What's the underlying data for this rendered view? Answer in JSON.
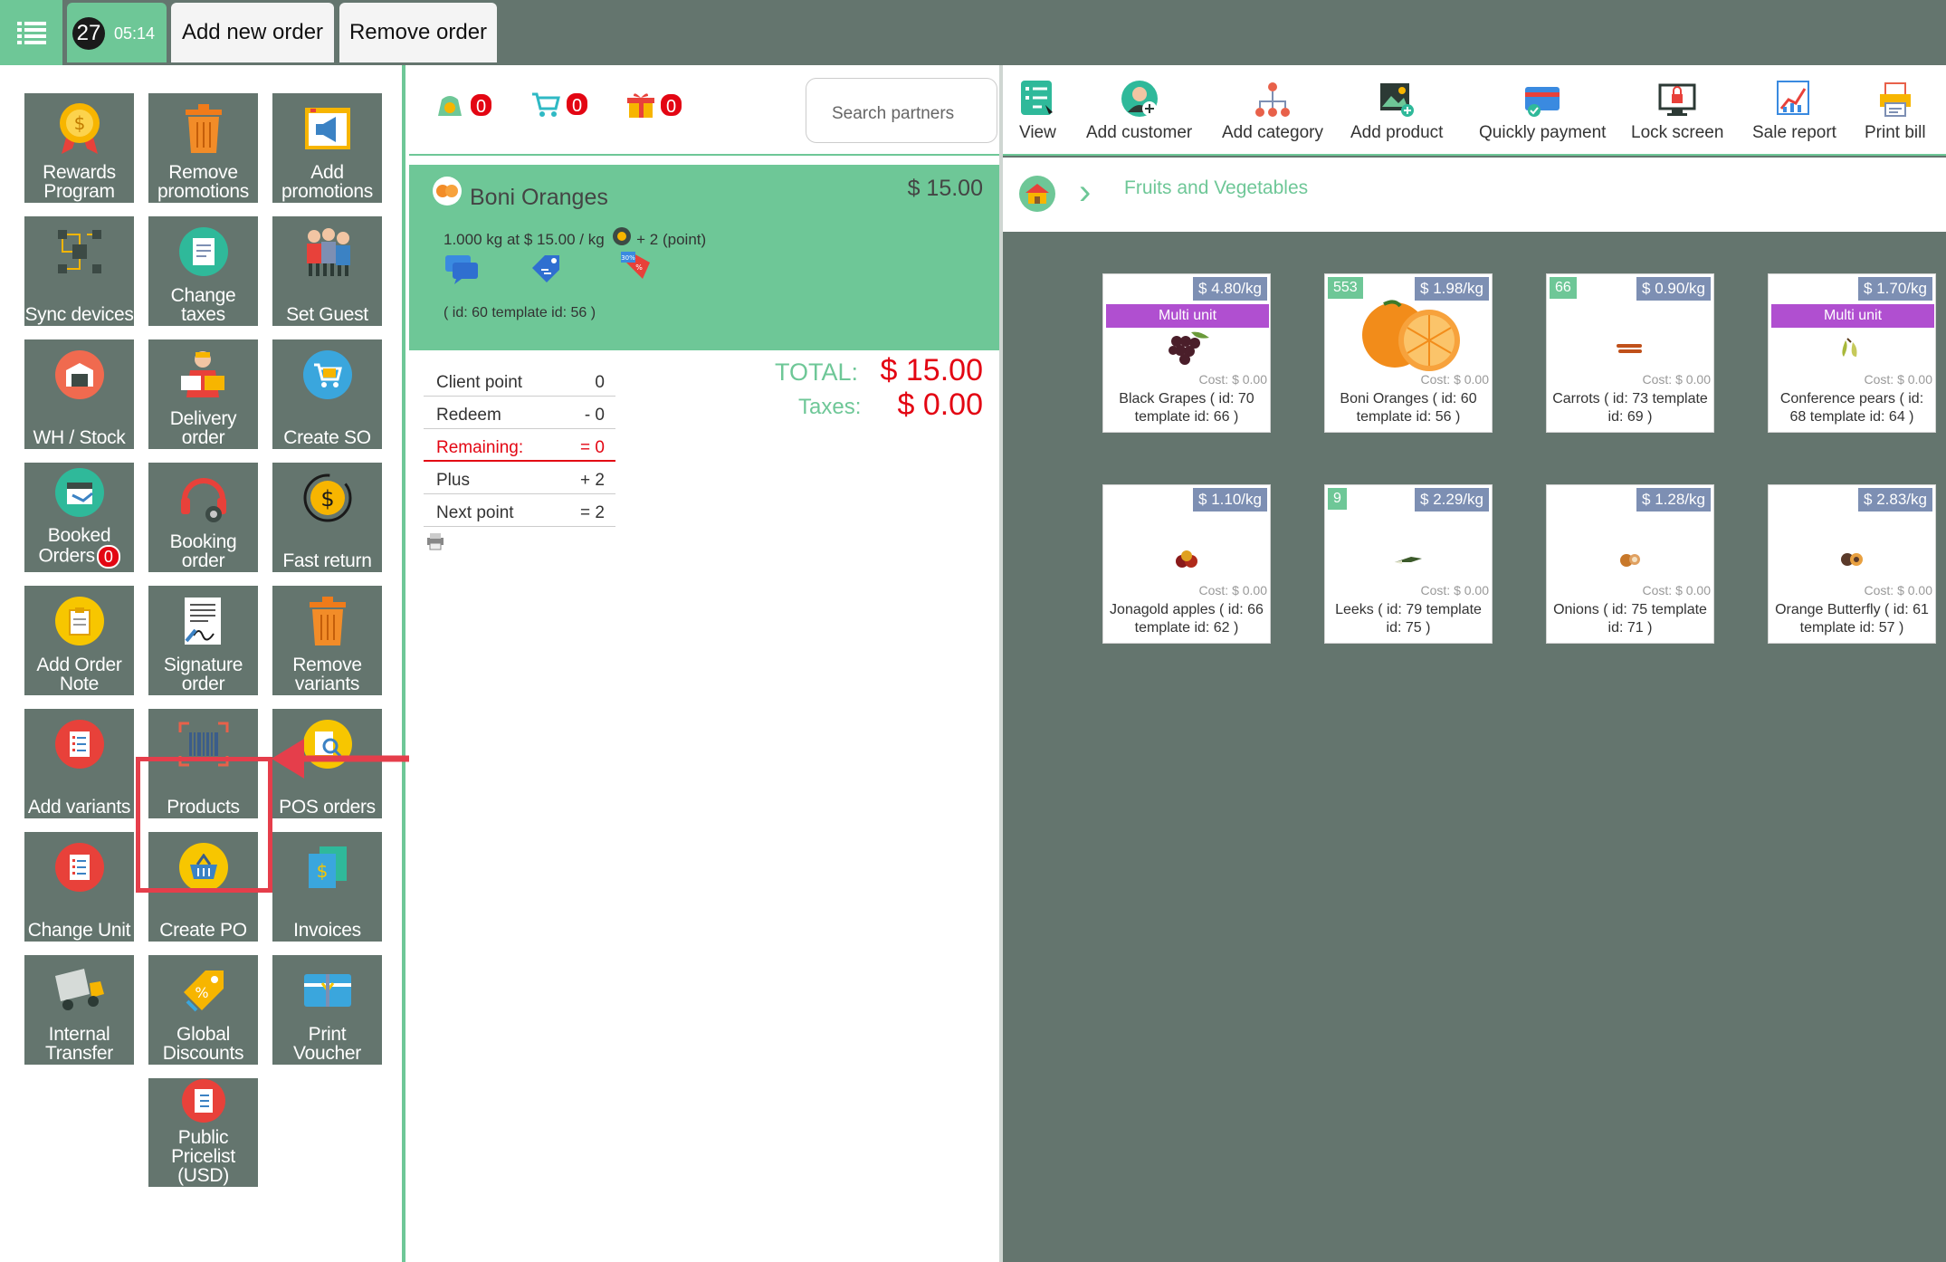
{
  "topbar": {
    "order_number": "27",
    "order_time": "05:14",
    "add_order": "Add new order",
    "remove_order": "Remove order"
  },
  "tiles": [
    {
      "label": "Rewards Program",
      "icon": "medal-icon"
    },
    {
      "label": "Remove promotions",
      "icon": "trash-icon"
    },
    {
      "label": "Add promotions",
      "icon": "megaphone-icon"
    },
    {
      "label": "Sync devices",
      "icon": "network-icon"
    },
    {
      "label": "Change taxes",
      "icon": "document-icon"
    },
    {
      "label": "Set Guest",
      "icon": "people-icon"
    },
    {
      "label": "WH / Stock",
      "icon": "warehouse-icon"
    },
    {
      "label": "Delivery order",
      "icon": "delivery-person-icon"
    },
    {
      "label": "Create SO",
      "icon": "cart-icon"
    },
    {
      "label": "Booked Orders",
      "icon": "calendar-icon",
      "badge": "0"
    },
    {
      "label": "Booking order",
      "icon": "headset-icon"
    },
    {
      "label": "Fast return",
      "icon": "dollar-return-icon"
    },
    {
      "label": "Add Order Note",
      "icon": "clipboard-icon"
    },
    {
      "label": "Signature order",
      "icon": "signature-icon"
    },
    {
      "label": "Remove variants",
      "icon": "trash-icon"
    },
    {
      "label": "Add variants",
      "icon": "checklist-icon"
    },
    {
      "label": "Products",
      "icon": "barcode-icon"
    },
    {
      "label": "POS orders",
      "icon": "search-document-icon"
    },
    {
      "label": "Change Unit",
      "icon": "checklist-icon"
    },
    {
      "label": "Create PO",
      "icon": "basket-icon"
    },
    {
      "label": "Invoices",
      "icon": "invoice-icon"
    },
    {
      "label": "Internal Transfer",
      "icon": "truck-icon"
    },
    {
      "label": "Global Discounts",
      "icon": "tag-icon"
    },
    {
      "label": "Print Voucher",
      "icon": "voucher-icon"
    },
    {
      "label": "Public Pricelist (USD)",
      "icon": "pricelist-icon"
    }
  ],
  "middle": {
    "counters": [
      "0",
      "0",
      "0"
    ],
    "search_placeholder": "Search partners",
    "line": {
      "name": "Boni Oranges",
      "price": "$ 15.00",
      "info": "1.000 kg at $ 15.00 / kg",
      "points": "+ 2 (point)",
      "ids": "( id: 60 template id: 56 )"
    },
    "points": [
      {
        "label": "Client point",
        "value": "0"
      },
      {
        "label": "Redeem",
        "value": "- 0"
      },
      {
        "label": "Remaining:",
        "value": "= 0"
      },
      {
        "label": "Plus",
        "value": "+ 2"
      },
      {
        "label": "Next point",
        "value": "= 2"
      }
    ],
    "total_label": "TOTAL:",
    "total_value": "$ 15.00",
    "taxes_label": "Taxes:",
    "taxes_value": "$ 0.00"
  },
  "tools": [
    {
      "label": "View",
      "icon": "view-list-icon"
    },
    {
      "label": "Add customer",
      "icon": "customer-icon"
    },
    {
      "label": "Add category",
      "icon": "hierarchy-icon"
    },
    {
      "label": "Add product",
      "icon": "product-image-icon"
    },
    {
      "label": "Quickly payment",
      "icon": "payment-icon"
    },
    {
      "label": "Lock screen",
      "icon": "monitor-lock-icon"
    },
    {
      "label": "Sale report",
      "icon": "chart-icon"
    },
    {
      "label": "Print bill",
      "icon": "printer-icon"
    }
  ],
  "breadcrumb": {
    "category": "Fruits and Vegetables"
  },
  "products": [
    {
      "price": "$ 4.80/kg",
      "multi": "Multi unit",
      "cost": "Cost: $ 0.00",
      "name": "Black Grapes ( id: 70 template id: 66 )"
    },
    {
      "price": "$ 1.98/kg",
      "qty": "553",
      "cost": "Cost: $ 0.00",
      "name": "Boni Oranges ( id: 60 template id: 56 )"
    },
    {
      "price": "$ 0.90/kg",
      "qty": "66",
      "cost": "Cost: $ 0.00",
      "name": "Carrots ( id: 73 template id: 69 )"
    },
    {
      "price": "$ 1.70/kg",
      "multi": "Multi unit",
      "cost": "Cost: $ 0.00",
      "name": "Conference pears ( id: 68 template id: 64 )"
    },
    {
      "price": "$ 1.10/kg",
      "cost": "Cost: $ 0.00",
      "name": "Jonagold apples ( id: 66 template id: 62 )"
    },
    {
      "price": "$ 2.29/kg",
      "qty": "9",
      "cost": "Cost: $ 0.00",
      "name": "Leeks ( id: 79 template id: 75 )"
    },
    {
      "price": "$ 1.28/kg",
      "cost": "Cost: $ 0.00",
      "name": "Onions ( id: 75 template id: 71 )"
    },
    {
      "price": "$ 2.83/kg",
      "cost": "Cost: $ 0.00",
      "name": "Orange Butterfly ( id: 61 template id: 57 )"
    }
  ]
}
